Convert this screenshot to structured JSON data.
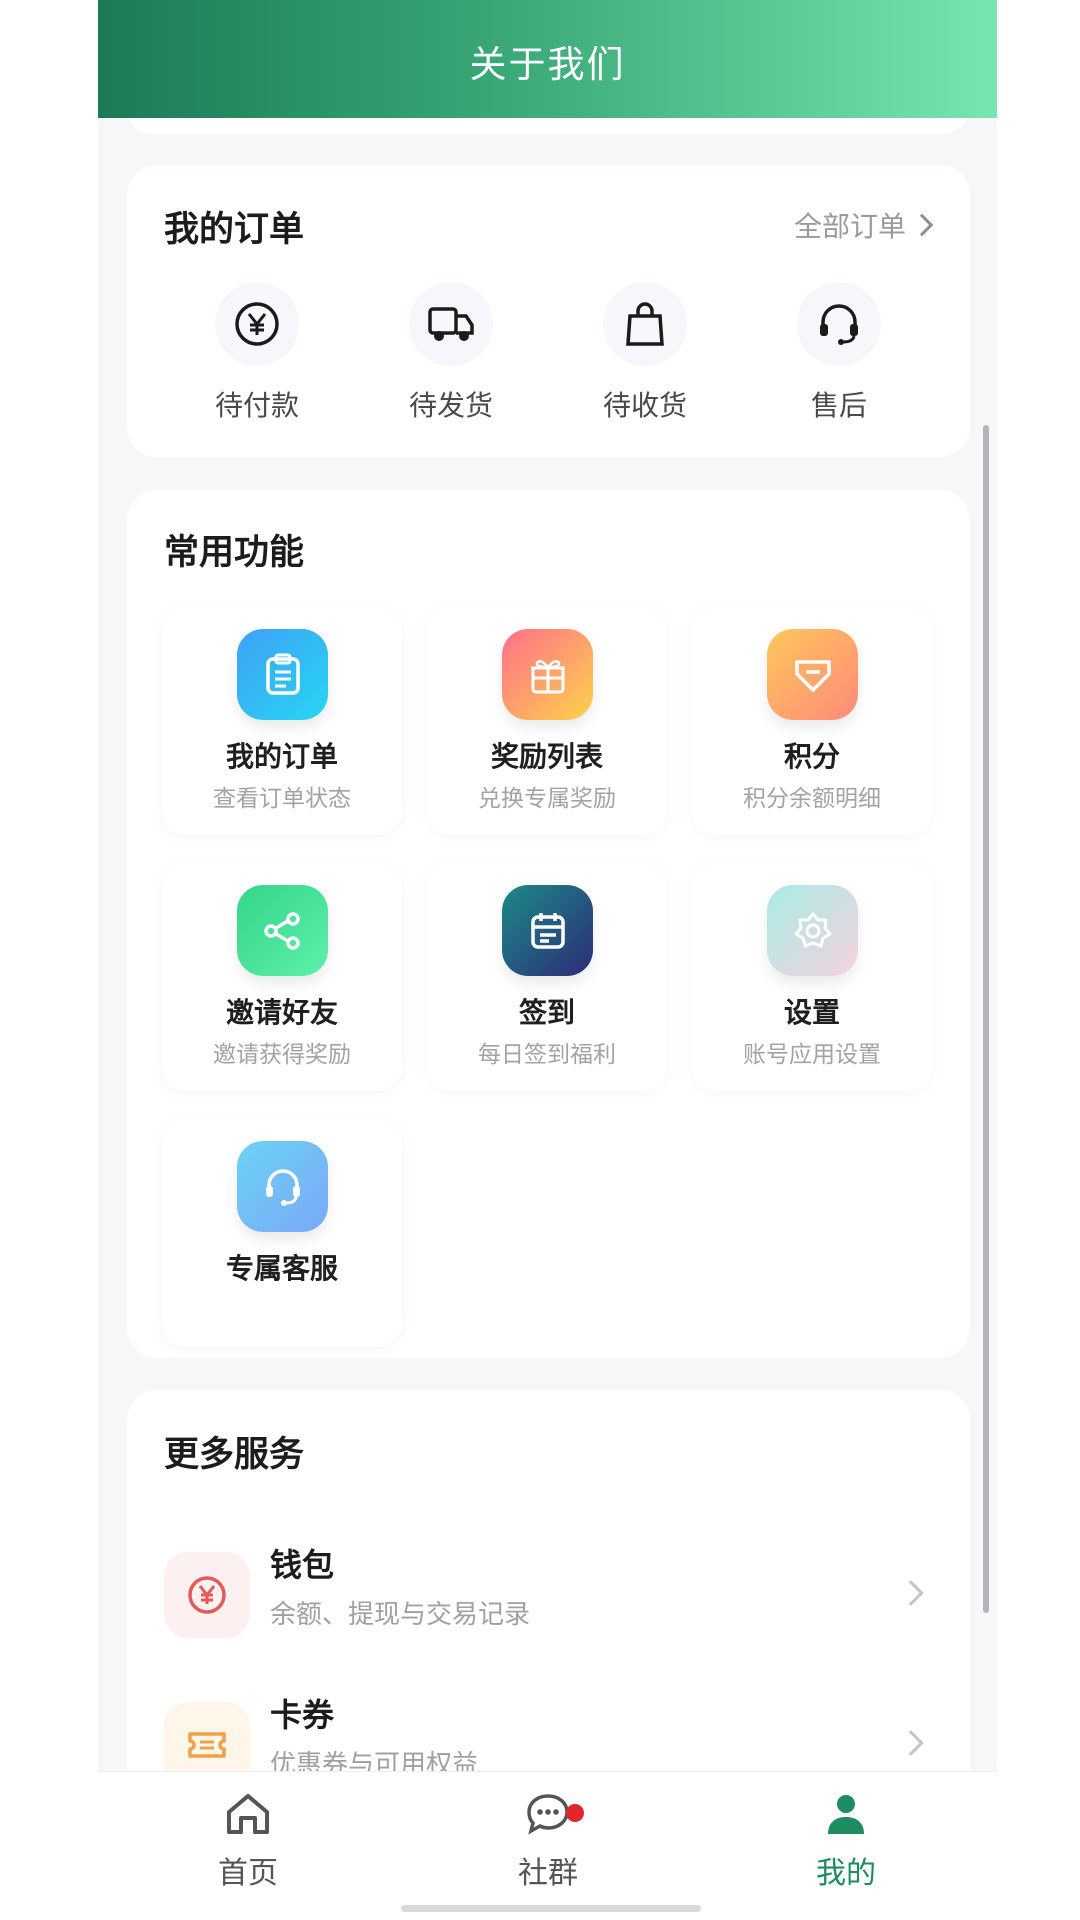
{
  "header": {
    "title": "关于我们"
  },
  "orders": {
    "title": "我的订单",
    "all_label": "全部订单",
    "items": [
      {
        "label": "待付款",
        "icon": "yen-circle-icon"
      },
      {
        "label": "待发货",
        "icon": "truck-icon"
      },
      {
        "label": "待收货",
        "icon": "shopping-bag-icon"
      },
      {
        "label": "售后",
        "icon": "headset-icon"
      }
    ]
  },
  "functions": {
    "title": "常用功能",
    "items": [
      {
        "title": "我的订单",
        "sub": "查看订单状态",
        "icon": "clipboard-icon",
        "color": "#2aa9f5"
      },
      {
        "title": "奖励列表",
        "sub": "兑换专属奖励",
        "icon": "gift-icon",
        "color": "#ff8a6a"
      },
      {
        "title": "积分",
        "sub": "积分余额明细",
        "icon": "points-icon",
        "color": "#ffa86a"
      },
      {
        "title": "邀请好友",
        "sub": "邀请获得奖励",
        "icon": "share-icon",
        "color": "#3ddc8a"
      },
      {
        "title": "签到",
        "sub": "每日签到福利",
        "icon": "calendar-icon",
        "color": "#2a4f7a"
      },
      {
        "title": "设置",
        "sub": "账号应用设置",
        "icon": "settings-icon",
        "color": "#c7ece8"
      },
      {
        "title": "专属客服",
        "sub": "",
        "icon": "customer-service-icon",
        "color": "#6cc4f8"
      }
    ]
  },
  "services": {
    "title": "更多服务",
    "items": [
      {
        "title": "钱包",
        "sub": "余额、提现与交易记录",
        "icon": "wallet-icon",
        "color": "#e35a5a"
      },
      {
        "title": "卡券",
        "sub": "优惠券与可用权益",
        "icon": "coupon-icon",
        "color": "#f0a04b"
      }
    ]
  },
  "tabbar": {
    "items": [
      {
        "label": "首页",
        "icon": "home-icon"
      },
      {
        "label": "社群",
        "icon": "chat-icon",
        "has_badge": true
      },
      {
        "label": "我的",
        "icon": "user-icon",
        "active": true
      }
    ],
    "accent": "#1e8c61"
  }
}
